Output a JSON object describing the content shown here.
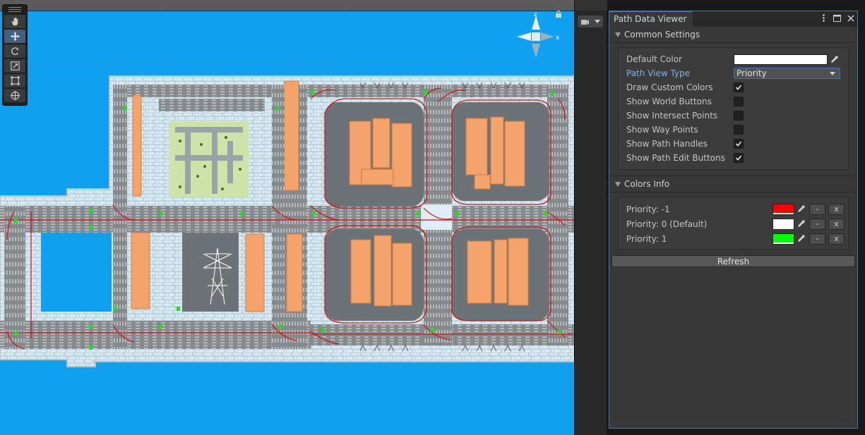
{
  "window": {
    "title": "Path Data Viewer"
  },
  "common_settings": {
    "header": "Common Settings",
    "default_color": {
      "label": "Default Color",
      "value": "#ffffff"
    },
    "path_view_type": {
      "label": "Path View Type",
      "selected": "Priority"
    },
    "checkboxes": [
      {
        "label": "Draw Custom Colors",
        "checked": true
      },
      {
        "label": "Show World Buttons",
        "checked": false
      },
      {
        "label": "Show Intersect Points",
        "checked": false
      },
      {
        "label": "Show Way Points",
        "checked": false
      },
      {
        "label": "Show Path Handles",
        "checked": true
      },
      {
        "label": "Show Path Edit Buttons",
        "checked": true
      }
    ]
  },
  "colors_info": {
    "header": "Colors Info",
    "rows": [
      {
        "label": "Priority: -1",
        "color": "#ff0000",
        "minus": "-",
        "remove": "x"
      },
      {
        "label": "Priority: 0 (Default)",
        "color": "#ffffff",
        "minus": "-",
        "remove": "x"
      },
      {
        "label": "Priority: 1",
        "color": "#00ff00",
        "minus": "-",
        "remove": "x"
      }
    ]
  },
  "refresh_label": "Refresh",
  "scene": {
    "gizmo": {
      "axis_z": "z",
      "axis_x": "x"
    },
    "tools": [
      "hand-tool",
      "move-tool",
      "rotate-tool",
      "scale-tool",
      "rect-tool",
      "transform-tool"
    ],
    "active_tool": "move-tool",
    "colors": {
      "water": "#0fa0f0",
      "ground": "#cfe6f2",
      "road": "#8a8f94",
      "building": "#f4a36b",
      "park": "#cfe3a8"
    }
  }
}
